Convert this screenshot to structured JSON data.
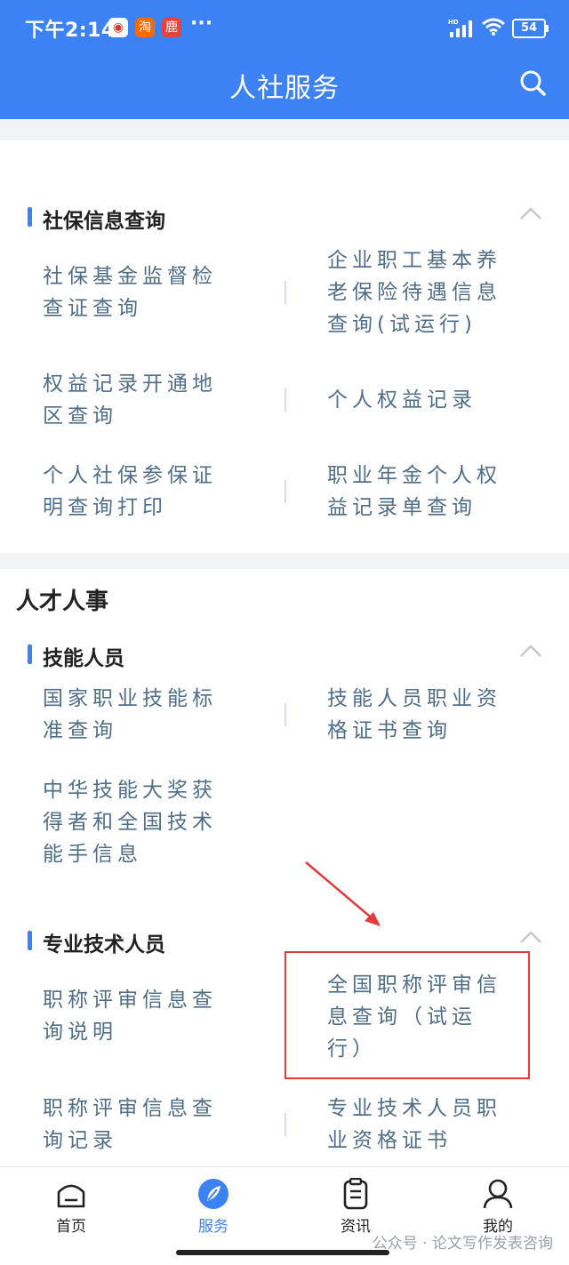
{
  "status_bar": {
    "time": "下午2:14",
    "app_icons": [
      "淘",
      "鹿"
    ],
    "more": "···",
    "network": "HD",
    "battery": "54"
  },
  "header": {
    "title": "人社服务"
  },
  "groups": [
    {
      "title": "社保信息查询",
      "rows": [
        {
          "left": "社保基金监督检查证查询",
          "right": "企业职工基本养老保险待遇信息查询(试运行)"
        },
        {
          "left": "权益记录开通地区查询",
          "right": "个人权益记录"
        },
        {
          "left": "个人社保参保证明查询打印",
          "right": "职业年金个人权益记录单查询"
        }
      ]
    }
  ],
  "category": {
    "title": "人才人事"
  },
  "talent_groups": [
    {
      "title": "技能人员",
      "rows": [
        {
          "left": "国家职业技能标准查询",
          "right": "技能人员职业资格证书查询"
        },
        {
          "left": "中华技能大奖获得者和全国技术能手信息",
          "right": ""
        }
      ]
    },
    {
      "title": "专业技术人员",
      "rows": [
        {
          "left": "职称评审信息查询说明",
          "right": "全国职称评审信息查询（试运行）"
        },
        {
          "left": "职称评审信息查询记录",
          "right": "专业技术人员职业资格证书"
        }
      ]
    }
  ],
  "tabs": [
    {
      "label": "首页",
      "icon": "home-icon"
    },
    {
      "label": "服务",
      "icon": "compass-icon",
      "active": true
    },
    {
      "label": "资讯",
      "icon": "news-icon"
    },
    {
      "label": "我的",
      "icon": "profile-icon"
    }
  ],
  "watermark": "公众号 · 论文写作发表咨询",
  "colors": {
    "primary": "#3c82f5",
    "item_text": "#506e88",
    "annotation": "#e23b3b"
  }
}
